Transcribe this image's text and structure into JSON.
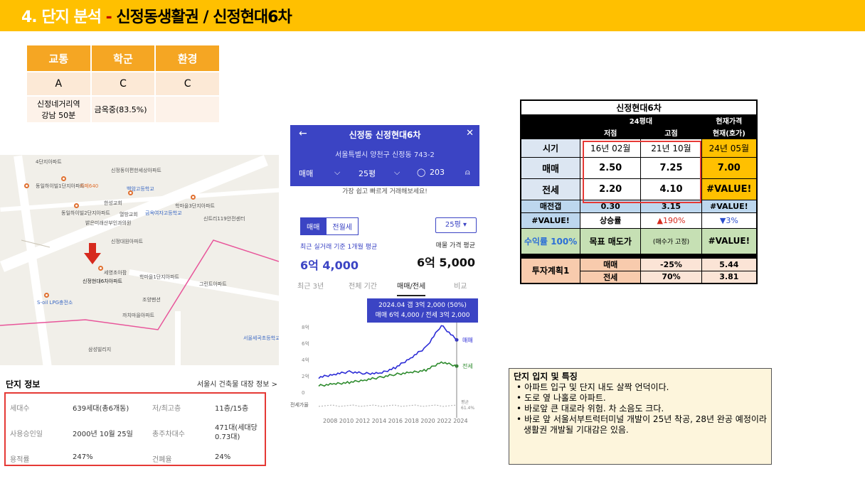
{
  "header": {
    "num": "4.",
    "part1": "단지 분석",
    "sep": " - ",
    "part2": "신정동생활권 /  신정현대6차"
  },
  "scores": {
    "headers": [
      "교통",
      "학군",
      "환경"
    ],
    "grades": [
      "A",
      "C",
      "C"
    ],
    "notes": [
      "신정네거리역\n강남 50분",
      "금옥중(83.5%)",
      ""
    ]
  },
  "map": {
    "labels": [
      "4단지아파트",
      "신정동이편한세상아파트",
      "동일하이빌1단지아파트",
      "카페640",
      "백암고등학교",
      "한성교회",
      "학마을3단지아파트",
      "동일하이빌2단지아파트",
      "열방교회",
      "금옥여자고등학교",
      "신트리119안전센터",
      "밝은미래산부인과의원",
      "신정대원아파트",
      "세영초아팜",
      "학마을1단지아파트",
      "신정현대6차아파트",
      "조양팬션",
      "그린트아파트",
      "S-oil LPG충전소",
      "까치마을아파트",
      "삼성빌리지",
      "서울세곡초등학교"
    ]
  },
  "complex_info": {
    "title": "단지 정보",
    "link": "서울시 건축물 대장 정보 >",
    "rows": [
      {
        "k1": "세대수",
        "v1": "639세대(총6개동)",
        "k2": "저/최고층",
        "v2": "11층/15층"
      },
      {
        "k1": "사용승인일",
        "v1": "2000년 10월 25일",
        "k2": "총주차대수",
        "v2": "471대(세대당 0.73대)"
      },
      {
        "k1": "용적률",
        "v1": "247%",
        "k2": "건폐율",
        "v2": "24%"
      }
    ]
  },
  "app": {
    "name": "신정동 신정현대6차",
    "address": "서울특별시 양천구 신정동 743-2",
    "filter_trade": "매매",
    "filter_size": "25평",
    "comments": "203",
    "subtitle": "가장 쉽고 빠르게 거래해보세요!",
    "seg_trade": "매매",
    "seg_rent": "전월세",
    "size_select": "25평",
    "recent_label": "최근 실거래 기준 1개월 평균",
    "recent_value": "6억 4,000",
    "avg_label": "매물 가격 평균",
    "avg_value": "6억 5,000",
    "tabs": [
      "최근 3년",
      "전체 기간",
      "매매/전세",
      "비교"
    ],
    "tooltip_line1": "2024.04  갭 3억 2,000 (50%)",
    "tooltip_line2": "매매 6억 4,000 / 전세 3억 2,000",
    "series_sale": "매매",
    "series_rent": "전세",
    "rate_label": "전세가율",
    "avg_tag": "평균",
    "avg_pct": "61.4%"
  },
  "chart_data": {
    "type": "line",
    "x": [
      2006,
      2008,
      2010,
      2012,
      2014,
      2016,
      2018,
      2020,
      2022,
      2024
    ],
    "xticks": [
      "2008",
      "2010",
      "2012",
      "2014",
      "2016",
      "2018",
      "2020",
      "2022",
      "2024"
    ],
    "yticks": [
      "8억",
      "6억",
      "4억",
      "2억",
      "0"
    ],
    "ylim": [
      0,
      8
    ],
    "series": [
      {
        "name": "매매",
        "color": "#2c2cd6",
        "values": [
          1.8,
          2.2,
          2.5,
          2.3,
          2.3,
          3.0,
          4.2,
          5.5,
          8.2,
          6.4
        ]
      },
      {
        "name": "전세",
        "color": "#2e8b2e",
        "values": [
          0.8,
          1.0,
          1.2,
          1.5,
          1.8,
          2.2,
          2.4,
          2.7,
          3.7,
          3.2
        ]
      }
    ]
  },
  "price_table": {
    "title": "신정현대6차",
    "size": "24평대",
    "current_hdr": "현재가격",
    "col_low": "저점",
    "col_high": "고점",
    "col_now": "현재(호가)",
    "row_time": "시기",
    "time_low": "16년 02월",
    "time_high": "21년 10월",
    "time_now": "24년 05월",
    "row_sale": "매매",
    "sale_low": "2.50",
    "sale_high": "7.25",
    "sale_now": "7.00",
    "row_rent": "전세",
    "rent_low": "2.20",
    "rent_high": "4.10",
    "rent_now": "#VALUE!",
    "row_gap": "매전갭",
    "gap_low": "0.30",
    "gap_high": "3.15",
    "gap_now": "#VALUE!",
    "value_err": "#VALUE!",
    "rise_lbl": "상승률",
    "rise_up": "▲190%",
    "rise_down": "▼3%",
    "yield_lbl": "수익률 100%",
    "target_lbl": "목표 매도가",
    "target_note": "(매수가 고정)",
    "target_val": "#VALUE!",
    "plan_lbl": "투자계획1",
    "plan_sale": "매매",
    "plan_sale_pct": "-25%",
    "plan_sale_val": "5.44",
    "plan_rent": "전세",
    "plan_rent_pct": "70%",
    "plan_rent_val": "3.81"
  },
  "notes": {
    "title": "단지 입지 및 특징",
    "items": [
      "아파트 입구 및 단지 내도 살짝 언덕이다.",
      "도로 옆 나홀로 아파트.",
      "바로앞 큰 대로라 위험. 차 소음도 크다.",
      "바로 앞 서울서부트럭터미널 개발이 25년 착공, 28년 완공 예정이라 생활권 개발될 기대감은 있음."
    ]
  },
  "colors": {
    "header": "#ffc000",
    "app_blue": "#3b44c4",
    "red_box": "#e53935"
  }
}
